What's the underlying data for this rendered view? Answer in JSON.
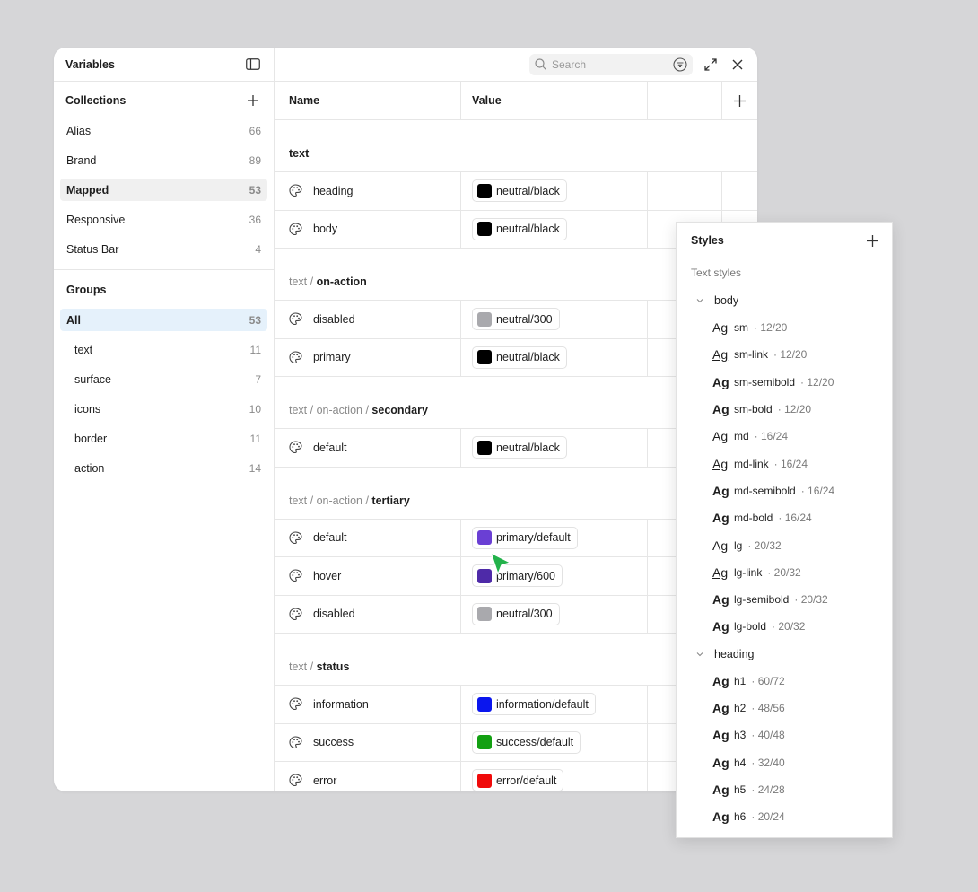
{
  "sidebar": {
    "title": "Variables",
    "collections_label": "Collections",
    "collections": [
      {
        "label": "Alias",
        "count": "66"
      },
      {
        "label": "Brand",
        "count": "89"
      },
      {
        "label": "Mapped",
        "count": "53"
      },
      {
        "label": "Responsive",
        "count": "36"
      },
      {
        "label": "Status Bar",
        "count": "4"
      }
    ],
    "groups_label": "Groups",
    "groups": [
      {
        "label": "All",
        "count": "53"
      },
      {
        "label": "text",
        "count": "11"
      },
      {
        "label": "surface",
        "count": "7"
      },
      {
        "label": "icons",
        "count": "10"
      },
      {
        "label": "border",
        "count": "11"
      },
      {
        "label": "action",
        "count": "14"
      }
    ]
  },
  "toolbar": {
    "search_placeholder": "Search"
  },
  "table": {
    "col_name": "Name",
    "col_value": "Value",
    "groups": [
      {
        "path": "",
        "sep": "",
        "last": "text",
        "rows": [
          {
            "name": "heading",
            "value": "neutral/black",
            "color": "#000000"
          },
          {
            "name": "body",
            "value": "neutral/black",
            "color": "#000000"
          }
        ]
      },
      {
        "path": "text",
        "sep": " / ",
        "last": "on-action",
        "rows": [
          {
            "name": "disabled",
            "value": "neutral/300",
            "color": "#a9a9ad"
          },
          {
            "name": "primary",
            "value": "neutral/black",
            "color": "#000000"
          }
        ]
      },
      {
        "path": "text / on-action",
        "sep": " / ",
        "last": "secondary",
        "rows": [
          {
            "name": "default",
            "value": "neutral/black",
            "color": "#000000"
          }
        ]
      },
      {
        "path": "text / on-action",
        "sep": " / ",
        "last": "tertiary",
        "rows": [
          {
            "name": "default",
            "value": "primary/default",
            "color": "#6a3fd4"
          },
          {
            "name": "hover",
            "value": "primary/600",
            "color": "#4e2aa8"
          },
          {
            "name": "disabled",
            "value": "neutral/300",
            "color": "#a9a9ad"
          }
        ]
      },
      {
        "path": "text",
        "sep": " / ",
        "last": "status",
        "rows": [
          {
            "name": "information",
            "value": "information/default",
            "color": "#0a16ee"
          },
          {
            "name": "success",
            "value": "success/default",
            "color": "#13a012"
          },
          {
            "name": "error",
            "value": "error/default",
            "color": "#f00a0a"
          }
        ]
      }
    ]
  },
  "styles": {
    "title": "Styles",
    "subtitle": "Text styles",
    "groups": [
      {
        "label": "body",
        "items": [
          {
            "ag": "Ag",
            "name": "sm",
            "meta": "· 12/20",
            "weight": "regular"
          },
          {
            "ag": "Ag",
            "name": "sm-link",
            "meta": "· 12/20",
            "weight": "link"
          },
          {
            "ag": "Ag",
            "name": "sm-semibold",
            "meta": "· 12/20",
            "weight": "bold"
          },
          {
            "ag": "Ag",
            "name": "sm-bold",
            "meta": "· 12/20",
            "weight": "bold"
          },
          {
            "ag": "Ag",
            "name": "md",
            "meta": "· 16/24",
            "weight": "regular"
          },
          {
            "ag": "Ag",
            "name": "md-link",
            "meta": "· 16/24",
            "weight": "link"
          },
          {
            "ag": "Ag",
            "name": "md-semibold",
            "meta": "· 16/24",
            "weight": "bold"
          },
          {
            "ag": "Ag",
            "name": "md-bold",
            "meta": "· 16/24",
            "weight": "bold"
          },
          {
            "ag": "Ag",
            "name": "lg",
            "meta": "· 20/32",
            "weight": "regular"
          },
          {
            "ag": "Ag",
            "name": "lg-link",
            "meta": "· 20/32",
            "weight": "link"
          },
          {
            "ag": "Ag",
            "name": "lg-semibold",
            "meta": "· 20/32",
            "weight": "bold"
          },
          {
            "ag": "Ag",
            "name": "lg-bold",
            "meta": "· 20/32",
            "weight": "bold"
          }
        ]
      },
      {
        "label": "heading",
        "items": [
          {
            "ag": "Ag",
            "name": "h1",
            "meta": "· 60/72",
            "weight": "bold"
          },
          {
            "ag": "Ag",
            "name": "h2",
            "meta": "· 48/56",
            "weight": "bold"
          },
          {
            "ag": "Ag",
            "name": "h3",
            "meta": "· 40/48",
            "weight": "bold"
          },
          {
            "ag": "Ag",
            "name": "h4",
            "meta": "· 32/40",
            "weight": "bold"
          },
          {
            "ag": "Ag",
            "name": "h5",
            "meta": "· 24/28",
            "weight": "bold"
          },
          {
            "ag": "Ag",
            "name": "h6",
            "meta": "· 20/24",
            "weight": "bold"
          }
        ]
      }
    ]
  },
  "colors": {
    "cursor": "#23b24b",
    "selected_blue": "#e5f1fb"
  }
}
